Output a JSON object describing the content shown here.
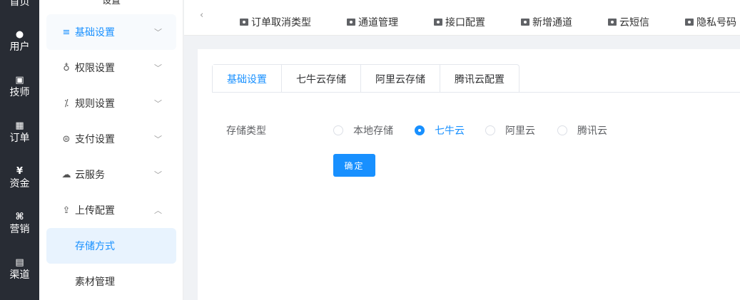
{
  "rail": {
    "items": [
      {
        "icon": "home-icon",
        "glyph": "",
        "label": "首页"
      },
      {
        "icon": "user-icon",
        "glyph": "●",
        "label": "用户"
      },
      {
        "icon": "technician-icon",
        "glyph": "▣",
        "label": "技师"
      },
      {
        "icon": "order-icon",
        "glyph": "▦",
        "label": "订单"
      },
      {
        "icon": "funds-icon",
        "glyph": "¥",
        "label": "资金"
      },
      {
        "icon": "marketing-icon",
        "glyph": "⌘",
        "label": "营销"
      },
      {
        "icon": "channel-icon",
        "glyph": "▤",
        "label": "渠道"
      }
    ]
  },
  "sidebar": {
    "top_label": "设置",
    "items": [
      {
        "icon": "list-icon",
        "glyph": "≡",
        "label": "基础设置",
        "chevron": "﹀"
      },
      {
        "icon": "user-outline-icon",
        "glyph": "♁",
        "label": "权限设置",
        "chevron": "﹀"
      },
      {
        "icon": "rule-icon",
        "glyph": "⁒",
        "label": "规则设置",
        "chevron": "﹀"
      },
      {
        "icon": "payment-icon",
        "glyph": "⊜",
        "label": "支付设置",
        "chevron": "﹀"
      },
      {
        "icon": "cloud-icon",
        "glyph": "☁",
        "label": "云服务",
        "chevron": "﹀"
      },
      {
        "icon": "upload-icon",
        "glyph": "⇪",
        "label": "上传配置",
        "chevron": "︿"
      }
    ],
    "sub_items": [
      {
        "label": "存储方式"
      },
      {
        "label": "素材管理"
      }
    ]
  },
  "topbar": {
    "back": "‹",
    "tabs": [
      {
        "label": "订单取消类型"
      },
      {
        "label": "通道管理"
      },
      {
        "label": "接口配置"
      },
      {
        "label": "新增通道"
      },
      {
        "label": "云短信"
      },
      {
        "label": "隐私号码"
      }
    ]
  },
  "card": {
    "tabs": [
      {
        "label": "基础设置"
      },
      {
        "label": "七牛云存储"
      },
      {
        "label": "阿里云存储"
      },
      {
        "label": "腾讯云配置"
      }
    ],
    "form": {
      "storage_label": "存储类型",
      "options": [
        {
          "label": "本地存储"
        },
        {
          "label": "七牛云"
        },
        {
          "label": "阿里云"
        },
        {
          "label": "腾讯云"
        }
      ],
      "selected": "七牛云",
      "submit": "确定"
    }
  },
  "colors": {
    "accent": "#1890ff",
    "rail_bg": "#282c34",
    "page_bg": "#f0f2f5"
  }
}
